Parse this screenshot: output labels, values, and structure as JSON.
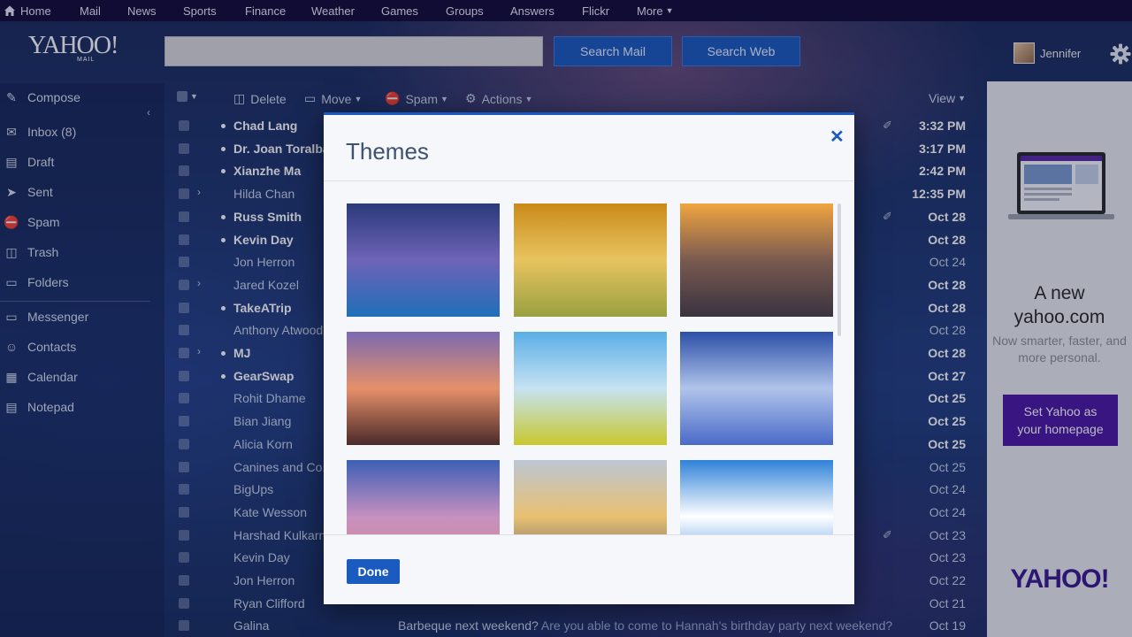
{
  "topnav": {
    "items": [
      "Home",
      "Mail",
      "News",
      "Sports",
      "Finance",
      "Weather",
      "Games",
      "Groups",
      "Answers",
      "Flickr",
      "More"
    ]
  },
  "header": {
    "logo_main": "YAHOO!",
    "logo_sub": "MAIL",
    "search_mail": "Search Mail",
    "search_web": "Search Web",
    "user_name": "Jennifer"
  },
  "sidebar": {
    "items": [
      {
        "label": "Compose",
        "icon": "compose-icon"
      },
      {
        "label": "Inbox (8)",
        "icon": "inbox-icon"
      },
      {
        "label": "Draft",
        "icon": "draft-icon"
      },
      {
        "label": "Sent",
        "icon": "sent-icon"
      },
      {
        "label": "Spam",
        "icon": "spam-icon"
      },
      {
        "label": "Trash",
        "icon": "trash-icon"
      },
      {
        "label": "Folders",
        "icon": "folder-icon"
      },
      {
        "label": "Messenger",
        "icon": "messenger-icon"
      },
      {
        "label": "Contacts",
        "icon": "contacts-icon"
      },
      {
        "label": "Calendar",
        "icon": "calendar-icon"
      },
      {
        "label": "Notepad",
        "icon": "notepad-icon"
      }
    ]
  },
  "toolbar": {
    "delete": "Delete",
    "move": "Move",
    "spam": "Spam",
    "actions": "Actions",
    "view": "View"
  },
  "messages": [
    {
      "from": "Chad Lang",
      "date": "3:32 PM",
      "unread": true,
      "attach": true
    },
    {
      "from": "Dr. Joan Toralba",
      "date": "3:17 PM",
      "unread": true
    },
    {
      "from": "Xianzhe Ma",
      "date": "2:42 PM",
      "unread": true
    },
    {
      "from": "Hilda Chan",
      "date": "12:35 PM",
      "unread": false,
      "thread": true,
      "bold_date": true
    },
    {
      "from": "Russ Smith",
      "date": "Oct 28",
      "unread": true,
      "attach": true
    },
    {
      "from": "Kevin Day",
      "date": "Oct 28",
      "unread": true
    },
    {
      "from": "Jon Herron",
      "date": "Oct 24",
      "unread": false
    },
    {
      "from": "Jared Kozel",
      "date": "Oct 28",
      "unread": false,
      "thread": true,
      "bold_date": true
    },
    {
      "from": "TakeATrip",
      "date": "Oct 28",
      "unread": true
    },
    {
      "from": "Anthony Atwood",
      "date": "Oct 28",
      "unread": false
    },
    {
      "from": "MJ",
      "date": "Oct 28",
      "unread": true,
      "thread": true
    },
    {
      "from": "GearSwap",
      "date": "Oct 27",
      "unread": true
    },
    {
      "from": "Rohit Dhame",
      "date": "Oct 25",
      "unread": false,
      "bold_date": true
    },
    {
      "from": "Bian Jiang",
      "date": "Oct 25",
      "unread": false,
      "bold_date": true
    },
    {
      "from": "Alicia Korn",
      "date": "Oct 25",
      "unread": false,
      "bold_date": true
    },
    {
      "from": "Canines and Co.",
      "date": "Oct 25",
      "unread": false
    },
    {
      "from": "BigUps",
      "date": "Oct 24",
      "unread": false
    },
    {
      "from": "Kate Wesson",
      "date": "Oct 24",
      "unread": false
    },
    {
      "from": "Harshad Kulkarni",
      "date": "Oct 23",
      "unread": false,
      "attach": true
    },
    {
      "from": "Kevin Day",
      "date": "Oct 23",
      "unread": false
    },
    {
      "from": "Jon Herron",
      "date": "Oct 22",
      "unread": false
    },
    {
      "from": "Ryan Clifford",
      "date": "Oct 21",
      "unread": false
    },
    {
      "from": "Galina",
      "date": "Oct 19",
      "unread": false,
      "subject": "Barbeque next weekend?",
      "preview": "Are you able to come to Hannah's birthday party next weekend?"
    }
  ],
  "ad": {
    "title": "A new yahoo.com",
    "subtitle": "Now smarter, faster, and more personal.",
    "button": "Set Yahoo as your homepage",
    "logo": "YAHOO!"
  },
  "modal": {
    "title": "Themes",
    "done": "Done",
    "themes": [
      {
        "name": "blue-pier-sunset",
        "top": "#2a3a7a",
        "mid": "#6f63b8",
        "bot": "#1f6fb8"
      },
      {
        "name": "golden-hills",
        "top": "#c98a1a",
        "mid": "#e7c460",
        "bot": "#9aa040"
      },
      {
        "name": "beach-sunset",
        "top": "#f0a540",
        "mid": "#7a5a50",
        "bot": "#3a3340"
      },
      {
        "name": "pink-beach-sunset",
        "top": "#7a6ab0",
        "mid": "#e6906a",
        "bot": "#4a2a2a"
      },
      {
        "name": "yellow-meadow-sky",
        "top": "#5aaee6",
        "mid": "#c6e2f2",
        "bot": "#c8c830"
      },
      {
        "name": "blue-coast",
        "top": "#2c4fa8",
        "mid": "#b0c4ea",
        "bot": "#4a6ac8"
      },
      {
        "name": "pink-clouds",
        "top": "#3d5fb5",
        "mid": "#c690c0",
        "bot": "#d98a8a"
      },
      {
        "name": "orange-dusk-clouds",
        "top": "#bcc6d4",
        "mid": "#e8c070",
        "bot": "#5a5a6a"
      },
      {
        "name": "white-clouds-blue-sky",
        "top": "#2f82d8",
        "mid": "#ffffff",
        "bot": "#3a8ae0"
      }
    ]
  }
}
